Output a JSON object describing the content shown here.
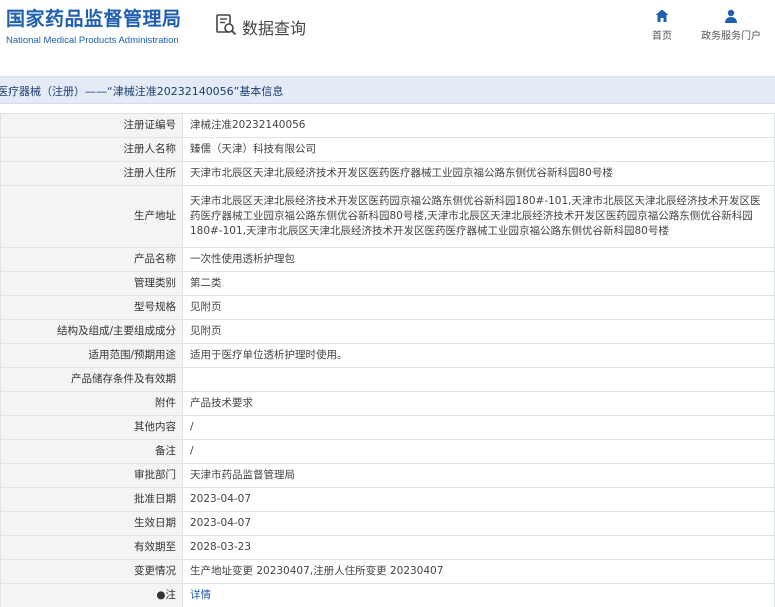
{
  "header": {
    "logo_cn": "国家药品监督管理局",
    "logo_en": "National Medical Products Administration",
    "section": "数据查询",
    "nav": [
      {
        "label": "首页",
        "icon": "home-icon"
      },
      {
        "label": "政务服务门户",
        "icon": "user-icon"
      }
    ]
  },
  "title_bar": "医疗器械（注册）——“津械注准20232140056”基本信息",
  "fields": [
    {
      "label": "注册证编号",
      "value": "津械注准20232140056"
    },
    {
      "label": "注册人名称",
      "value": "臻儒（天津）科技有限公司"
    },
    {
      "label": "注册人住所",
      "value": "天津市北辰区天津北辰经济技术开发区医药医疗器械工业园京福公路东侧优谷新科园80号楼"
    },
    {
      "label": "生产地址",
      "value": "天津市北辰区天津北辰经济技术开发区医药园京福公路东侧优谷新科园180#-101,天津市北辰区天津北辰经济技术开发区医药医疗器械工业园京福公路东侧优谷新科园80号楼,天津市北辰区天津北辰经济技术开发区医药园京福公路东侧优谷新科园180#-101,天津市北辰区天津北辰经济技术开发区医药医疗器械工业园京福公路东侧优谷新科园80号楼"
    },
    {
      "label": "产品名称",
      "value": "一次性使用透析护理包"
    },
    {
      "label": "管理类别",
      "value": "第二类"
    },
    {
      "label": "型号规格",
      "value": "见附页"
    },
    {
      "label": "结构及组成/主要组成成分",
      "value": "见附页"
    },
    {
      "label": "适用范围/预期用途",
      "value": "适用于医疗单位透析护理时使用。"
    },
    {
      "label": "产品储存条件及有效期",
      "value": ""
    },
    {
      "label": "附件",
      "value": "产品技术要求"
    },
    {
      "label": "其他内容",
      "value": "/"
    },
    {
      "label": "备注",
      "value": "/"
    },
    {
      "label": "审批部门",
      "value": "天津市药品监督管理局"
    },
    {
      "label": "批准日期",
      "value": "2023-04-07"
    },
    {
      "label": "生效日期",
      "value": "2023-04-07"
    },
    {
      "label": "有效期至",
      "value": "2028-03-23"
    },
    {
      "label": "变更情况",
      "value": "生产地址变更 20230407,注册人住所变更 20230407"
    },
    {
      "label": "●注",
      "value": "详情"
    }
  ],
  "colors": {
    "brand": "#1f5fb0",
    "title_bar_bg": "#e4ebf6",
    "label_bg": "#f4f4f4",
    "border": "#dfe2e8"
  }
}
